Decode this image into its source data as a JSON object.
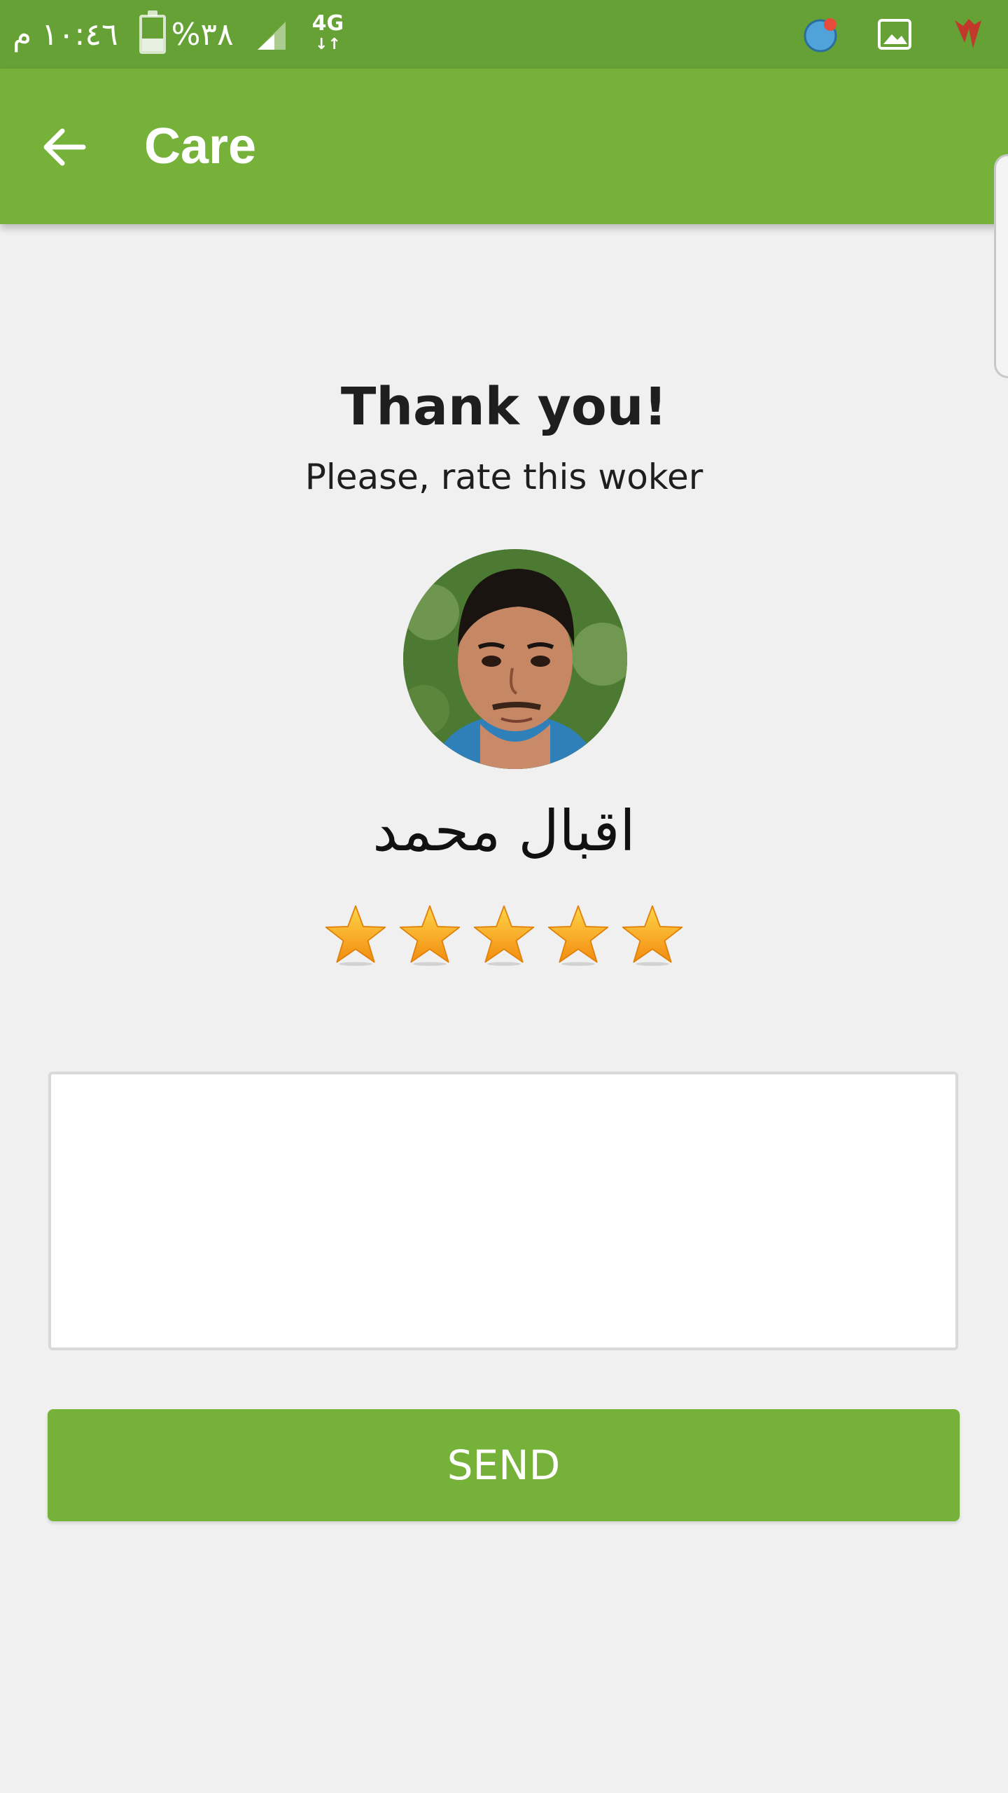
{
  "status_bar": {
    "time": "١٠:٤٦ م",
    "battery": "%٣٨",
    "battery_level": 0.38,
    "network": "4G"
  },
  "app_bar": {
    "title": "Care",
    "back_icon": "arrow-left-icon"
  },
  "rating": {
    "title": "Thank you!",
    "subtitle": "Please, rate this woker",
    "worker_name": "اقبال محمد",
    "stars_selected": 5,
    "stars_total": 5
  },
  "comment": {
    "value": "",
    "placeholder": ""
  },
  "send_button": {
    "label": "SEND"
  },
  "colors": {
    "status_bar": "#66a136",
    "primary": "#76b23a",
    "background": "#f0f0f0",
    "star": "#f7a21b"
  }
}
